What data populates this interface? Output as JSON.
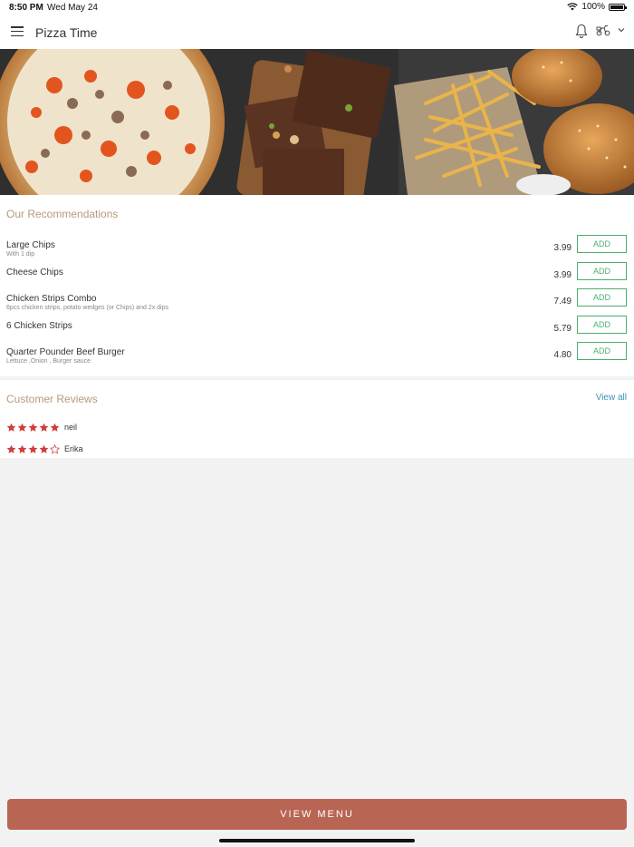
{
  "status_bar": {
    "time": "8:50 PM",
    "date": "Wed May 24",
    "battery": "100%",
    "battery_level": 1.0
  },
  "header": {
    "title": "Pizza Time"
  },
  "recommendations": {
    "title": "Our Recommendations",
    "items": [
      {
        "name": "Large Chips",
        "desc": "With 1 dip",
        "price": "3.99",
        "add_label": "ADD"
      },
      {
        "name": "Cheese Chips",
        "desc": "",
        "price": "3.99",
        "add_label": "ADD"
      },
      {
        "name": "Chicken Strips Combo",
        "desc": "6pcs chicken strips, potato wedges (or Chips) and 2x dips",
        "price": "7.49",
        "add_label": "ADD"
      },
      {
        "name": "6 Chicken Strips",
        "desc": "",
        "price": "5.79",
        "add_label": "ADD"
      },
      {
        "name": "Quarter Pounder Beef Burger",
        "desc": "Lettuce ,Onion , Burger sauce",
        "price": "4.80",
        "add_label": "ADD"
      }
    ]
  },
  "reviews": {
    "title": "Customer Reviews",
    "view_all": "View all",
    "items": [
      {
        "name": "neil",
        "rating": 5
      },
      {
        "name": "Erika",
        "rating": 4
      }
    ]
  },
  "footer": {
    "view_menu": "VIEW MENU"
  },
  "colors": {
    "accent": "#b96553",
    "add_green": "#4caf6e",
    "section_title": "#b59b7c",
    "link": "#3b8fb7",
    "star": "#d23c3c"
  }
}
